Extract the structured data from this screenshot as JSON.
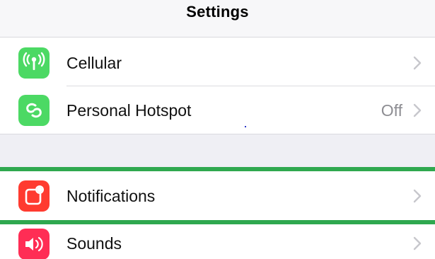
{
  "header": {
    "title": "Settings"
  },
  "rows": [
    {
      "label": "Cellular",
      "value": "",
      "icon": "cellular-antenna-icon",
      "color": "#4cd964"
    },
    {
      "label": "Personal Hotspot",
      "value": "Off",
      "icon": "hotspot-link-icon",
      "color": "#4cd964"
    },
    {
      "label": "Notifications",
      "value": "",
      "icon": "notifications-icon",
      "color": "#ff3b30"
    },
    {
      "label": "Sounds",
      "value": "",
      "icon": "speaker-icon",
      "color": "#ff2d55"
    }
  ],
  "colors": {
    "highlight": "#2fa84f",
    "group_gap": "#efeff4",
    "secondary_text": "#8e8e93"
  }
}
